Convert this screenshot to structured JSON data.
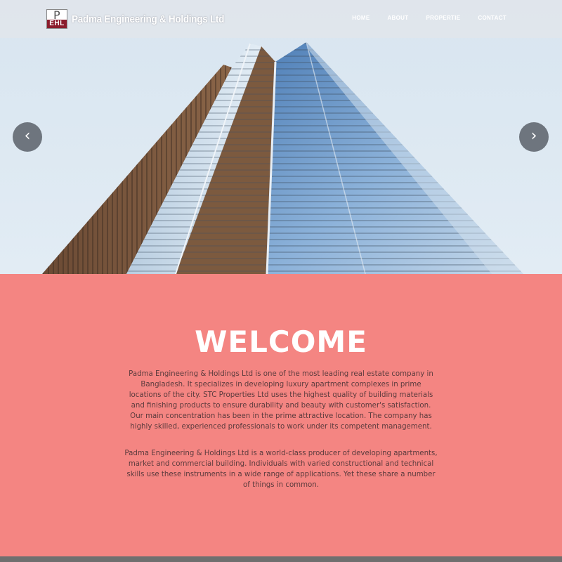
{
  "brand": {
    "logo_letter": "P",
    "logo_abbr": "EHL",
    "name": "Padma Engineering & Holdings Ltd"
  },
  "nav": {
    "items": [
      {
        "label": "HOME"
      },
      {
        "label": "ABOUT"
      },
      {
        "label": "PROPERTIE"
      },
      {
        "label": "CONTACT"
      }
    ]
  },
  "slider": {
    "prev_glyph": "‹",
    "next_glyph": "›"
  },
  "welcome": {
    "title": "WELCOME",
    "paragraph1": "Padma Engineering & Holdings Ltd is one of the most leading real estate company in Bangladesh. It specializes in developing luxury apartment complexes in prime locations of the city. STC Properties Ltd uses the highest quality of building materials and finishing products to ensure durability and beauty with customer's satisfaction. Our main concentration has been in the prime attractive location. The company has highly skilled, experienced professionals to work under its competent management.",
    "paragraph2": "Padma Engineering & Holdings Ltd is a world-class producer of developing apartments, market and commercial building. Individuals with varied constructional and technical skills use these instruments in a wide range of applications. Yet these share a number of things in common."
  },
  "colors": {
    "accent": "#f48582",
    "logo_red": "#8b1d2c",
    "nav_bg": "#e1e5eb",
    "footer": "#6f6f6f"
  }
}
